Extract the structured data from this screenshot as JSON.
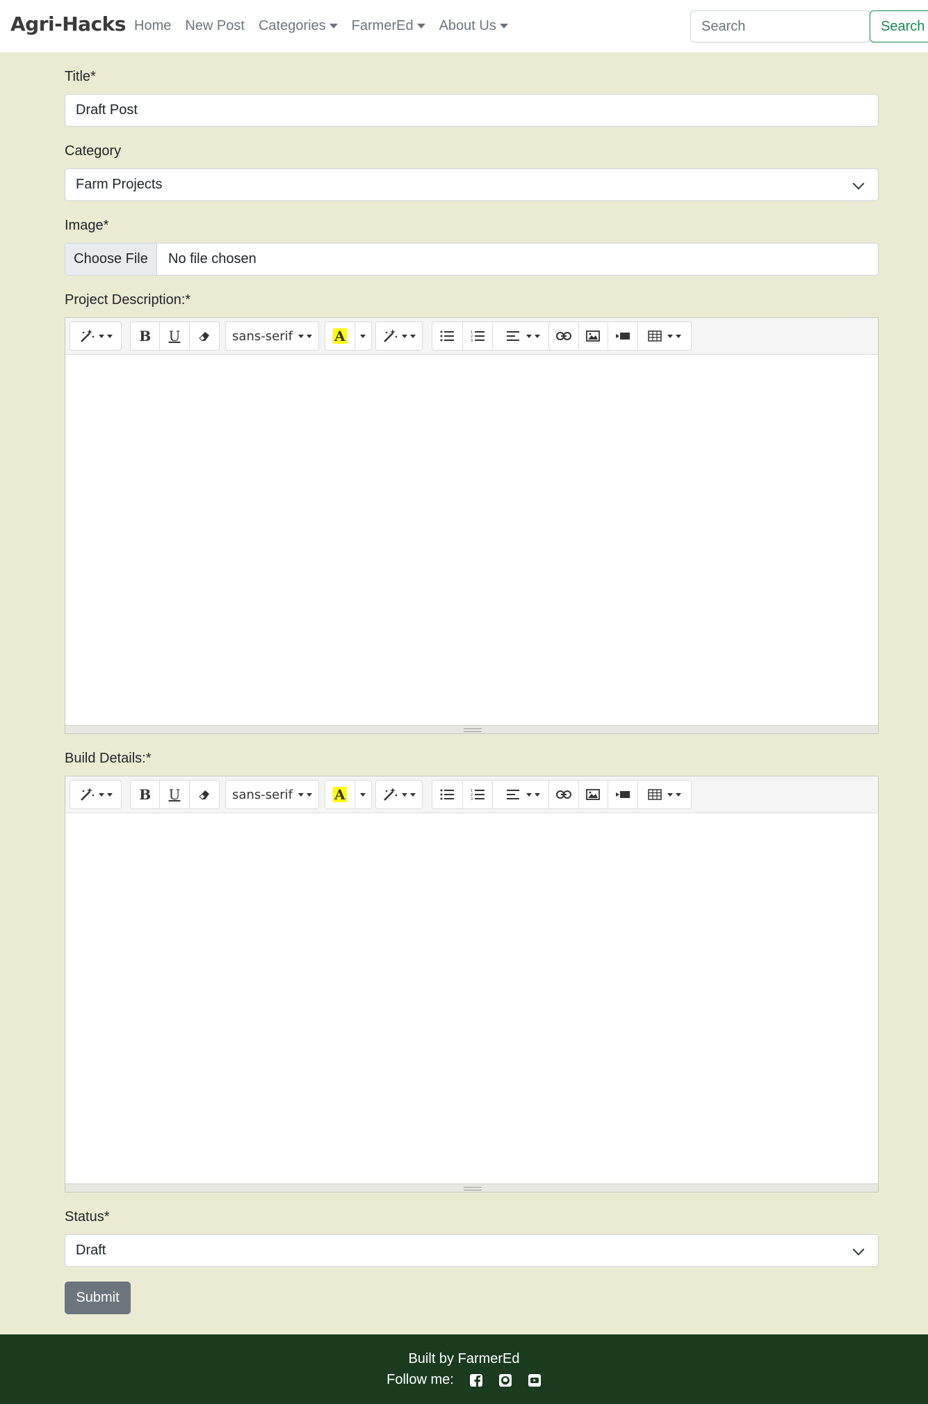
{
  "navbar": {
    "brand": "Agri-Hacks",
    "links": [
      {
        "label": "Home",
        "dropdown": false
      },
      {
        "label": "New Post",
        "dropdown": false
      },
      {
        "label": "Categories",
        "dropdown": true
      },
      {
        "label": "FarmerEd",
        "dropdown": true
      },
      {
        "label": "About Us",
        "dropdown": true
      }
    ],
    "search_placeholder": "Search",
    "search_button": "Search"
  },
  "form": {
    "title_label": "Title*",
    "title_value": "Draft Post",
    "category_label": "Category",
    "category_value": "Farm Projects",
    "image_label": "Image*",
    "file_button": "Choose File",
    "file_status": "No file chosen",
    "description_label": "Project Description:*",
    "build_label": "Build Details:*",
    "status_label": "Status*",
    "status_value": "Draft",
    "submit_label": "Submit"
  },
  "editor_toolbar": {
    "font_name": "sans-serif",
    "bold": "B",
    "underline": "U",
    "color_letter": "A"
  },
  "colors": {
    "page_bg": "#ebebd3",
    "footer_bg": "#1b3b1f",
    "search_accent": "#198754",
    "submit_bg": "#6c757d",
    "highlight": "#ffff00"
  },
  "footer": {
    "built_by": "Built by FarmerEd",
    "follow": "Follow me:",
    "social_icons": [
      "facebook-icon",
      "github-icon",
      "youtube-icon"
    ]
  }
}
